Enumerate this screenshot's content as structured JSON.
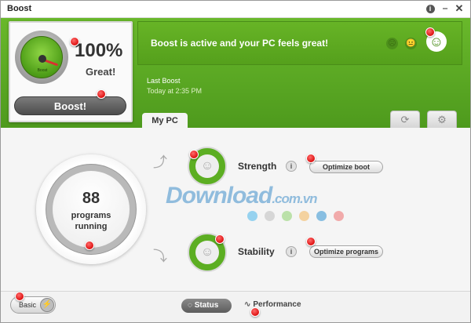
{
  "window": {
    "title": "Boost",
    "info_icon": "i",
    "minimize_icon": "minimize-icon",
    "close_icon": "close-icon"
  },
  "gauge": {
    "label": "Boost",
    "percent": "100%",
    "status": "Great!",
    "button": "Boost!"
  },
  "banner": {
    "message": "Boost is active and your PC feels great!",
    "faces": [
      "sad-face-icon",
      "neutral-face-icon",
      "happy-face-icon"
    ]
  },
  "last_boost": {
    "label": "Last Boost",
    "time": "Today at 2:35 PM"
  },
  "tabs": {
    "my_pc": "My PC",
    "icons": [
      "refresh-icon",
      "gear-icon"
    ]
  },
  "programs": {
    "count": "88",
    "label_line1": "programs",
    "label_line2": "running"
  },
  "metrics": [
    {
      "name": "Strength",
      "info": "i",
      "button": "Optimize boot"
    },
    {
      "name": "Stability",
      "info": "i",
      "button": "Optimize programs"
    }
  ],
  "watermark": {
    "brand": "Download",
    "domain": ".com.vn",
    "dot_colors": [
      "#6ec3ec",
      "#c9c9c9",
      "#a2d889",
      "#f4c37a",
      "#5aa6d8",
      "#f08a8a"
    ]
  },
  "bottom": {
    "basic": "Basic",
    "status": "Status",
    "performance": "Performance"
  },
  "colors": {
    "accent_green": "#5aa81f",
    "marker_red": "#d11111"
  }
}
